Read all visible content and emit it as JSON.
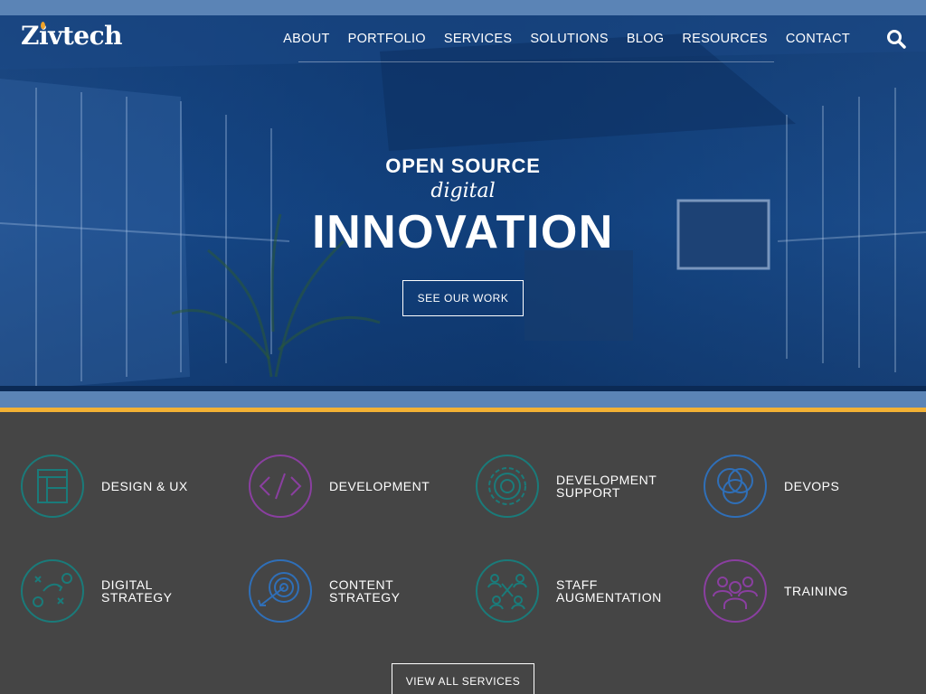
{
  "brand": {
    "logo_text": "Zivtech"
  },
  "nav": {
    "items": [
      {
        "label": "ABOUT"
      },
      {
        "label": "PORTFOLIO"
      },
      {
        "label": "SERVICES"
      },
      {
        "label": "SOLUTIONS"
      },
      {
        "label": "BLOG"
      },
      {
        "label": "RESOURCES"
      },
      {
        "label": "CONTACT"
      }
    ],
    "search_icon": "search-icon"
  },
  "hero": {
    "line1": "OPEN SOURCE",
    "line2": "digital",
    "line3": "INNOVATION",
    "cta_label": "SEE OUR WORK"
  },
  "services": {
    "items": [
      {
        "line1": "DESIGN & UX",
        "line2": "",
        "icon": "layout-icon",
        "color": "#1a7b7a"
      },
      {
        "line1": "DEVELOPMENT",
        "line2": "",
        "icon": "code-icon",
        "color": "#8a3fa0"
      },
      {
        "line1": "DEVELOPMENT",
        "line2": "SUPPORT",
        "icon": "gear-icon",
        "color": "#1a7b7a"
      },
      {
        "line1": "DEVOPS",
        "line2": "",
        "icon": "venn-icon",
        "color": "#2f6fb8"
      },
      {
        "line1": "DIGITAL",
        "line2": "STRATEGY",
        "icon": "strategy-play-icon",
        "color": "#1a7b7a"
      },
      {
        "line1": "CONTENT",
        "line2": "STRATEGY",
        "icon": "target-icon",
        "color": "#2f6fb8"
      },
      {
        "line1": "STAFF",
        "line2": "AUGMENTATION",
        "icon": "people-network-icon",
        "color": "#1a7b7a"
      },
      {
        "line1": "TRAINING",
        "line2": "",
        "icon": "group-icon",
        "color": "#8a3fa0"
      }
    ],
    "view_all_label": "VIEW ALL SERVICES"
  },
  "colors": {
    "header_band": "#5b84b6",
    "accent_gold": "#f2b134",
    "services_bg": "#454545",
    "teal": "#1a7b7a",
    "purple": "#8a3fa0",
    "blue": "#2f6fb8"
  }
}
